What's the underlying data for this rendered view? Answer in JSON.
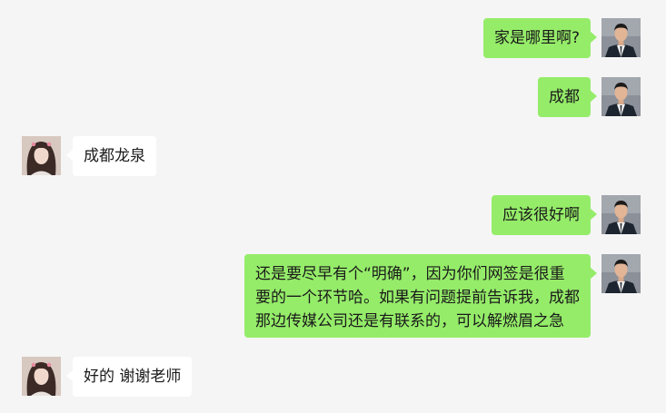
{
  "messages": [
    {
      "sender": "self",
      "text": "家是哪里啊?"
    },
    {
      "sender": "self",
      "text": "成都"
    },
    {
      "sender": "other",
      "text": "成都龙泉"
    },
    {
      "sender": "self",
      "text": "应该很好啊"
    },
    {
      "sender": "self",
      "text": "还是要尽早有个“明确”，因为你们网签是很重\n要的一个环节哈。如果有问题提前告诉我，成都\n那边传媒公司还是有联系的，可以解燃眉之急"
    },
    {
      "sender": "other",
      "text": "好的 谢谢老师"
    }
  ],
  "colors": {
    "background": "#f5f5f5",
    "self_bubble": "#95ec69",
    "other_bubble": "#ffffff",
    "text": "#1a1a1a"
  },
  "icons": {
    "self_avatar": "avatar-man-in-suit-icon",
    "other_avatar": "avatar-woman-icon"
  }
}
